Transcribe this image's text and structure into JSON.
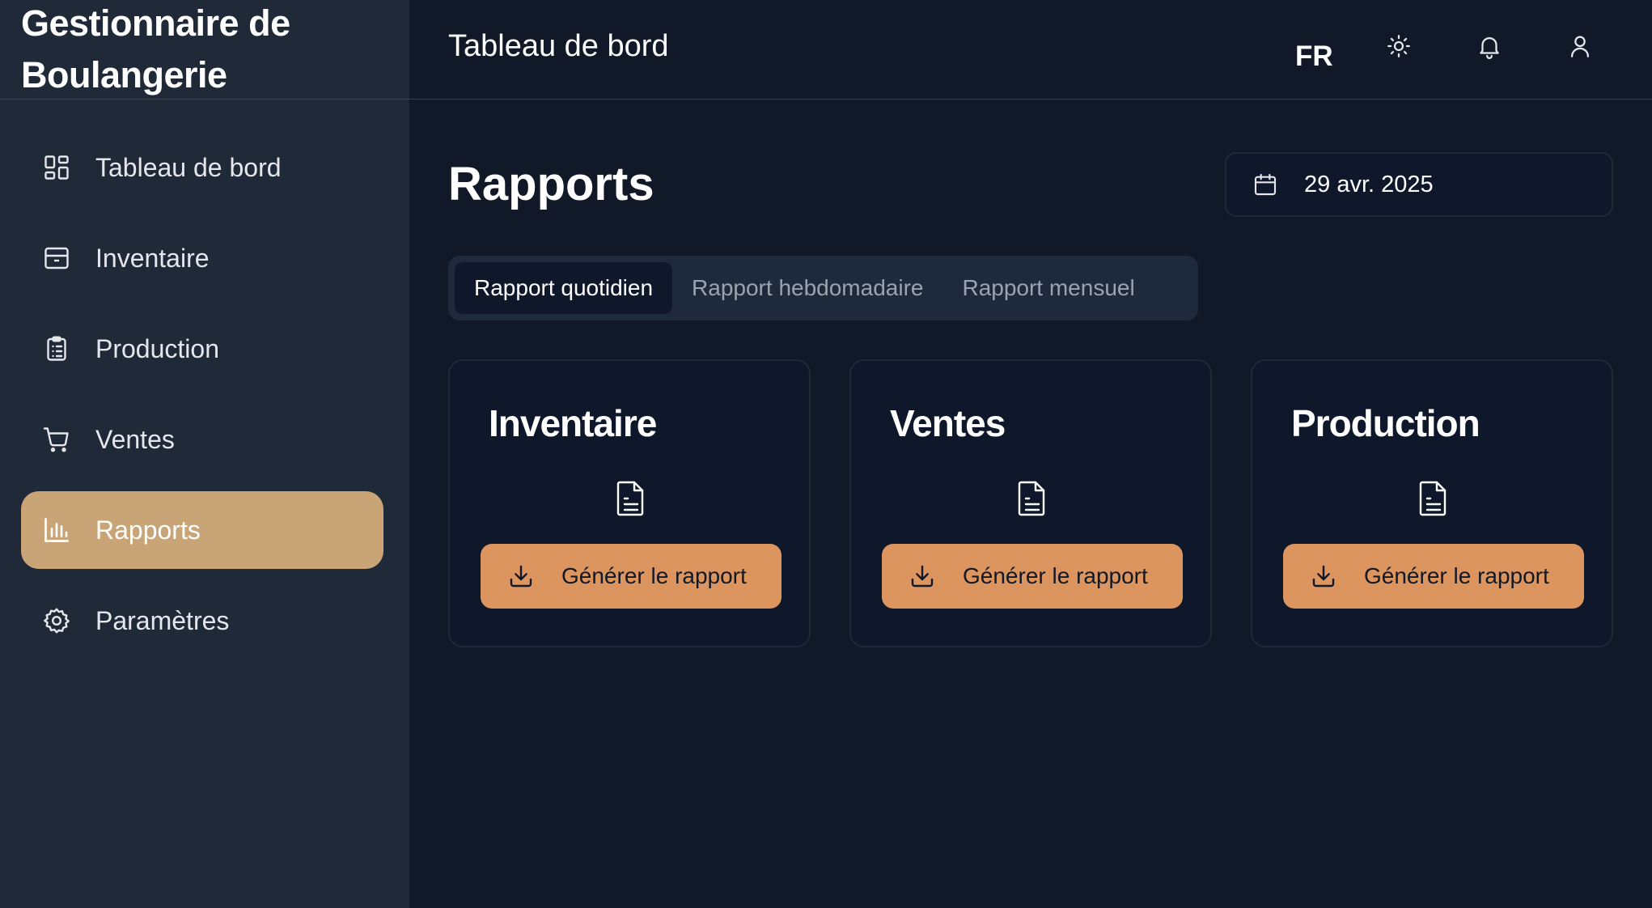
{
  "app": {
    "title": "Gestionnaire de Boulangerie"
  },
  "sidebar": {
    "items": [
      {
        "label": "Tableau de bord",
        "icon": "dashboard-icon"
      },
      {
        "label": "Inventaire",
        "icon": "package-icon"
      },
      {
        "label": "Production",
        "icon": "clipboard-list-icon"
      },
      {
        "label": "Ventes",
        "icon": "shopping-cart-icon"
      },
      {
        "label": "Rapports",
        "icon": "bar-chart-icon",
        "active": true
      },
      {
        "label": "Paramètres",
        "icon": "gear-icon"
      }
    ]
  },
  "header": {
    "title": "Tableau de bord",
    "language": "FR",
    "icons": [
      "sun-icon",
      "bell-icon",
      "user-icon"
    ]
  },
  "main": {
    "title": "Rapports",
    "date": "29 avr. 2025",
    "tabs": [
      {
        "label": "Rapport quotidien",
        "active": true
      },
      {
        "label": "Rapport hebdomadaire",
        "active": false
      },
      {
        "label": "Rapport mensuel",
        "active": false
      }
    ],
    "cards": [
      {
        "title": "Inventaire",
        "button_label": "Générer le rapport"
      },
      {
        "title": "Ventes",
        "button_label": "Générer le rapport"
      },
      {
        "title": "Production",
        "button_label": "Générer le rapport"
      }
    ]
  },
  "colors": {
    "background": "#111827",
    "sidebar": "#1f2937",
    "active_nav": "#c8a476",
    "button": "#dc955f"
  }
}
